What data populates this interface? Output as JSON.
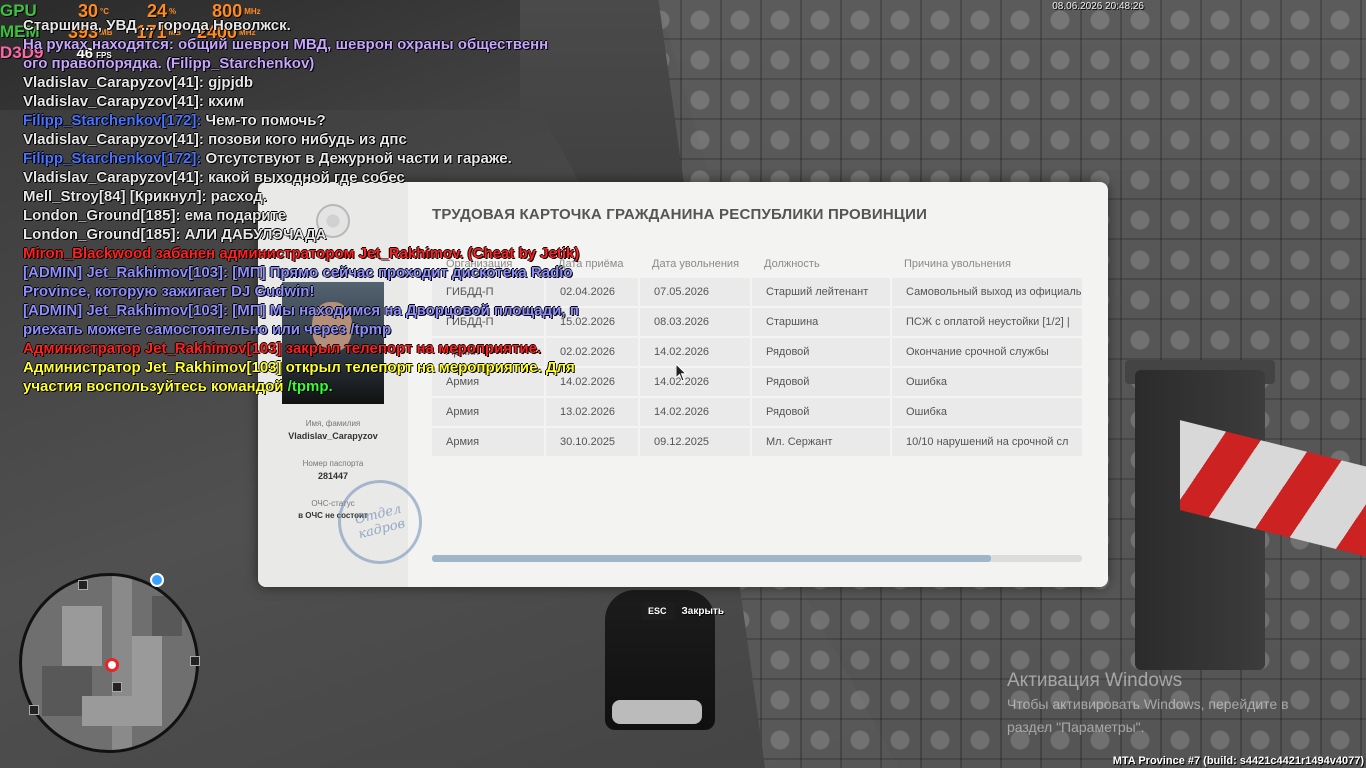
{
  "hud": {
    "gpu": {
      "label": "GPU",
      "temp": "30",
      "temp_unit": "°C",
      "load": "24",
      "load_unit": "%",
      "clock": "800",
      "clock_unit": "MHz"
    },
    "mem": {
      "label": "MEM",
      "used": "393",
      "used_unit": "MB",
      "b": "171",
      "b_unit": "MB",
      "clock": "2400",
      "clock_unit": "MHz"
    },
    "d3d": {
      "label": "D3D9",
      "fps": "46",
      "fps_unit": "FPS"
    },
    "datetime": "08.06.2026 20:48:26"
  },
  "chat": [
    {
      "segments": [
        {
          "text": "Старшина, УВД ... города Новолжск.",
          "color": "white"
        }
      ]
    },
    {
      "segments": [
        {
          "text": "На руках находятся: общий шеврон МВД, шеврон охраны общественн",
          "color": "purple"
        }
      ]
    },
    {
      "segments": [
        {
          "text": "ого правопорядка. (Filipp_Starchenkov)",
          "color": "purple"
        }
      ]
    },
    {
      "segments": [
        {
          "text": "Vladislav_Carapyzov[41]: gjpjdb",
          "color": "white"
        }
      ]
    },
    {
      "segments": [
        {
          "text": "Vladislav_Carapyzov[41]: кхим",
          "color": "white"
        }
      ]
    },
    {
      "segments": [
        {
          "text": "Filipp_Starchenkov[172]:",
          "color": "blue"
        },
        {
          "text": " Чем-то помочь?",
          "color": "white"
        }
      ]
    },
    {
      "segments": [
        {
          "text": "Vladislav_Carapyzov[41]: позови кого нибудь из дпс",
          "color": "white"
        }
      ]
    },
    {
      "segments": [
        {
          "text": "Filipp_Starchenkov[172]:",
          "color": "blue"
        },
        {
          "text": " Отсутствуют в Дежурной части и гараже.",
          "color": "white"
        }
      ]
    },
    {
      "segments": [
        {
          "text": "Vladislav_Carapyzov[41]: какой выходной где собес",
          "color": "white"
        }
      ]
    },
    {
      "segments": [
        {
          "text": "Mell_Stroy[84] [Крикнул]: расход.",
          "color": "white"
        }
      ]
    },
    {
      "segments": [
        {
          "text": "London_Ground[185]: ема подарите",
          "color": "white"
        }
      ]
    },
    {
      "segments": [
        {
          "text": "London_Ground[185]: АЛИ ДАБУЛЭЧАДА",
          "color": "white"
        }
      ]
    },
    {
      "segments": [
        {
          "text": "Miron_Blackwood забанен администратором Jet_Rakhimov. (Cheat by Jetik)",
          "color": "red"
        }
      ]
    },
    {
      "segments": [
        {
          "text": "[ADMIN] Jet_Rakhimov[103]: [МП] Прямо сейчас проходит дискотека Radio",
          "color": "admin"
        }
      ]
    },
    {
      "segments": [
        {
          "text": " Province, которую зажигает DJ Gudwin!",
          "color": "admin"
        }
      ]
    },
    {
      "segments": [
        {
          "text": "[ADMIN] Jet_Rakhimov[103]: [МП] Мы находимся на Дворцовой площади, п",
          "color": "admin"
        }
      ]
    },
    {
      "segments": [
        {
          "text": "риехать можете самостоятельно или через /tpmp",
          "color": "admin"
        }
      ]
    },
    {
      "segments": [
        {
          "text": "Администратор Jet_Rakhimov[103] закрыл телепорт на мероприятие.",
          "color": "red"
        }
      ]
    },
    {
      "segments": [
        {
          "text": "Администратор Jet_Rakhimov[103] открыл телепорт на мероприятие. Для",
          "color": "yellow"
        }
      ]
    },
    {
      "segments": [
        {
          "text": " участия воспользуйтесь командой ",
          "color": "yellow"
        },
        {
          "text": "/tpmp.",
          "color": "green"
        }
      ]
    }
  ],
  "card": {
    "title": "ТРУДОВАЯ КАРТОЧКА ГРАЖДАНИНА РЕСПУБЛИКИ ПРОВИНЦИИ",
    "name_label": "Имя, фамилия",
    "name_value": "Vladislav_Carapyzov",
    "passport_label": "Номер паспорта",
    "passport_value": "281447",
    "ochs_label": "ОЧС-статус",
    "ochs_value": "в ОЧС не состоит",
    "stamp_text": "Отдел кадров",
    "columns": [
      "Организация",
      "Дата приёма",
      "Дата увольнения",
      "Должность",
      "Причина увольнения"
    ],
    "rows": [
      [
        "ГИБДД-П",
        "02.04.2026",
        "07.05.2026",
        "Старший лейтенант",
        "Самовольный выход из официаль"
      ],
      [
        "ГИБДД-П",
        "15.02.2026",
        "08.03.2026",
        "Старшина",
        "ПСЖ с оплатой неустойки [1/2] |"
      ],
      [
        "Армия",
        "02.02.2026",
        "14.02.2026",
        "Рядовой",
        "Окончание срочной службы"
      ],
      [
        "Армия",
        "14.02.2026",
        "14.02.2026",
        "Рядовой",
        "Ошибка"
      ],
      [
        "Армия",
        "13.02.2026",
        "14.02.2026",
        "Рядовой",
        "Ошибка"
      ],
      [
        "Армия",
        "30.10.2025",
        "09.12.2025",
        "Мл. Сержант",
        "10/10 нарушений на срочной сл"
      ]
    ],
    "scroll_fraction": 0.86
  },
  "close_hint": {
    "key": "ESC",
    "label": "Закрыть"
  },
  "watermark": {
    "title": "Активация Windows",
    "line1": "Чтобы активировать Windows, перейдите в",
    "line2": "раздел \"Параметры\"."
  },
  "build": "MTA Province #7 (build: s4421c4421r1494v4077)",
  "colors": {
    "chat_white": "#e8e8e8",
    "chat_purple": "#c7a6ff",
    "chat_blue": "#4a73ff",
    "chat_red": "#ff2020",
    "chat_admin": "#8e8eff",
    "chat_yellow": "#ffff30",
    "chat_green": "#33ff33"
  }
}
